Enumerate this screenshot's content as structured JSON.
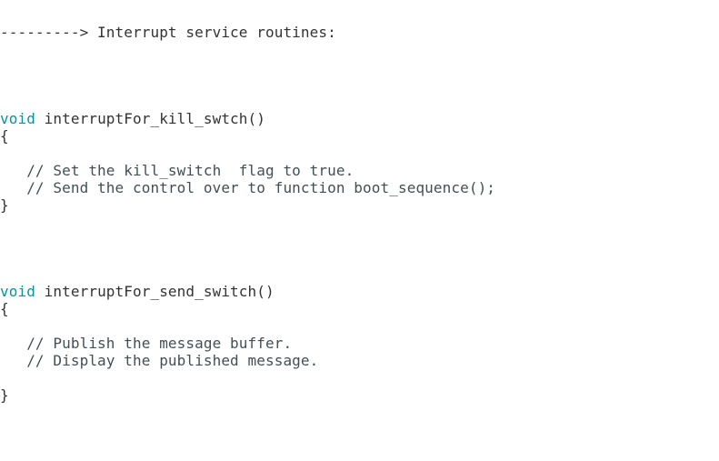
{
  "colors": {
    "background": "#ffffff",
    "text": "#333333",
    "keyword": "#00979c",
    "comment": "#434f54"
  },
  "editor": {
    "heading": "---------> Interrupt service routines:",
    "block1": {
      "keyword": "void",
      "signature": " interruptFor_kill_swtch()",
      "open_brace": "{",
      "comments": [
        "   // Set the kill_switch  flag to true.",
        "   // Send the control over to function boot_sequence();"
      ],
      "close_brace": "}"
    },
    "block2": {
      "keyword": "void",
      "signature": " interruptFor_send_switch()",
      "open_brace": "{",
      "comments": [
        "   // Publish the message buffer.",
        "   // Display the published message."
      ],
      "close_brace": "}"
    }
  }
}
